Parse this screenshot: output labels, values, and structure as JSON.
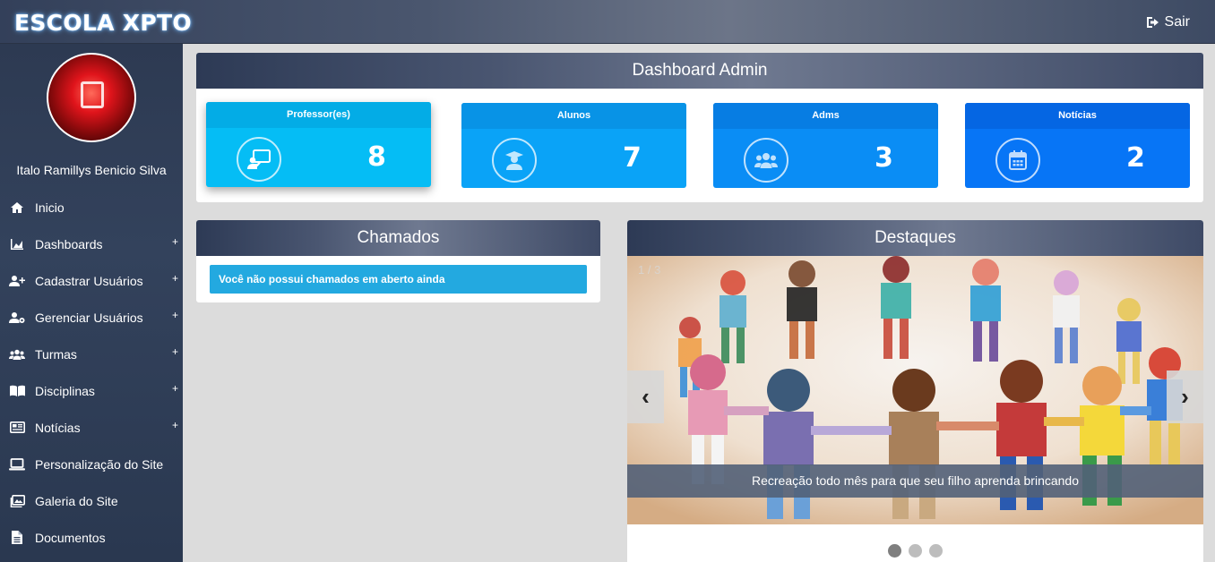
{
  "header": {
    "brand": "ESCOLA XPTO",
    "logout_label": "Sair",
    "logout_icon": "sign-out-icon"
  },
  "sidebar": {
    "user_name": "Italo Ramillys Benicio Silva",
    "items": [
      {
        "label": "Inicio",
        "icon": "home-icon",
        "expandable": false
      },
      {
        "label": "Dashboards",
        "icon": "chart-area-icon",
        "expandable": true
      },
      {
        "label": "Cadastrar Usuários",
        "icon": "user-plus-icon",
        "expandable": true
      },
      {
        "label": "Gerenciar Usuários",
        "icon": "user-cog-icon",
        "expandable": true
      },
      {
        "label": "Turmas",
        "icon": "users-icon",
        "expandable": true
      },
      {
        "label": "Disciplinas",
        "icon": "book-open-icon",
        "expandable": true
      },
      {
        "label": "Notícias",
        "icon": "newspaper-icon",
        "expandable": true
      },
      {
        "label": "Personalização do Site",
        "icon": "laptop-icon",
        "expandable": false
      },
      {
        "label": "Galeria do Site",
        "icon": "images-icon",
        "expandable": false
      },
      {
        "label": "Documentos",
        "icon": "file-icon",
        "expandable": false
      }
    ],
    "plus_glyph": "+"
  },
  "dashboard": {
    "title": "Dashboard Admin",
    "cards": [
      {
        "title": "Professor(es)",
        "value": "8",
        "icon": "chalkboard-teacher-icon",
        "color": "#05bdf5",
        "header_color": "#03ace6"
      },
      {
        "title": "Alunos",
        "value": "7",
        "icon": "user-graduate-icon",
        "color": "#0aa3f7",
        "header_color": "#0893e6"
      },
      {
        "title": "Adms",
        "value": "3",
        "icon": "users-icon",
        "color": "#0a8df5",
        "header_color": "#077de3"
      },
      {
        "title": "Notícias",
        "value": "2",
        "icon": "calendar-icon",
        "color": "#0775f6",
        "header_color": "#0566e3"
      }
    ]
  },
  "chamados": {
    "title": "Chamados",
    "message": "Você não possui chamados em aberto ainda"
  },
  "destaques": {
    "title": "Destaques",
    "counter": "1 / 3",
    "caption": "Recreação todo mês para que seu filho aprenda brincando",
    "prev": "‹",
    "next": "›",
    "slide_count": 3,
    "active_slide": 1
  }
}
